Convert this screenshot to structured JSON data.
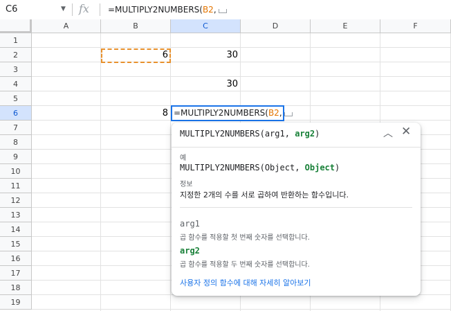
{
  "formula_bar": {
    "name_box": "C6",
    "fx_label": "fx",
    "formula_prefix": "=MULTIPLY2NUMBERS(",
    "formula_ref": "B2",
    "formula_suffix": ","
  },
  "columns": [
    "A",
    "B",
    "C",
    "D",
    "E",
    "F"
  ],
  "rows": [
    "1",
    "2",
    "3",
    "4",
    "5",
    "6",
    "7",
    "8",
    "9",
    "10",
    "11",
    "12",
    "13",
    "14",
    "15",
    "16",
    "17",
    "18",
    "19"
  ],
  "cells": {
    "B2": "6",
    "C2": "30",
    "C4": "30",
    "B6": "8"
  },
  "active_cell": "C6",
  "editor": {
    "prefix": "=MULTIPLY2NUMBERS(",
    "ref": "B2",
    "suffix": ","
  },
  "help_popup": {
    "sig_name": "MULTIPLY2NUMBERS(",
    "sig_arg1": "arg1",
    "sig_sep": ", ",
    "sig_arg2": "arg2",
    "sig_close": ")",
    "example_label": "예",
    "example_name": "MULTIPLY2NUMBERS(",
    "example_arg1": "Object",
    "example_sep": ", ",
    "example_arg2": "Object",
    "example_close": ")",
    "info_label": "정보",
    "info_text": "지정한 2개의 수를 서로 곱하여 반환하는 함수입니다.",
    "arg1_name": "arg1",
    "arg1_desc": "곱 함수를 적용할 첫 번째 숫자를 선택합니다.",
    "arg2_name": "arg2",
    "arg2_desc": "곱 함수를 적용할 두 번째 숫자를 선택합니다.",
    "learn_more": "사용자 정의 함수에 대해 자세히 알아보기"
  },
  "colors": {
    "selection_blue": "#1a73e8",
    "copy_marquee": "#e8912d",
    "active_arg_green": "#188038",
    "range_ref_orange": "#e37400"
  }
}
